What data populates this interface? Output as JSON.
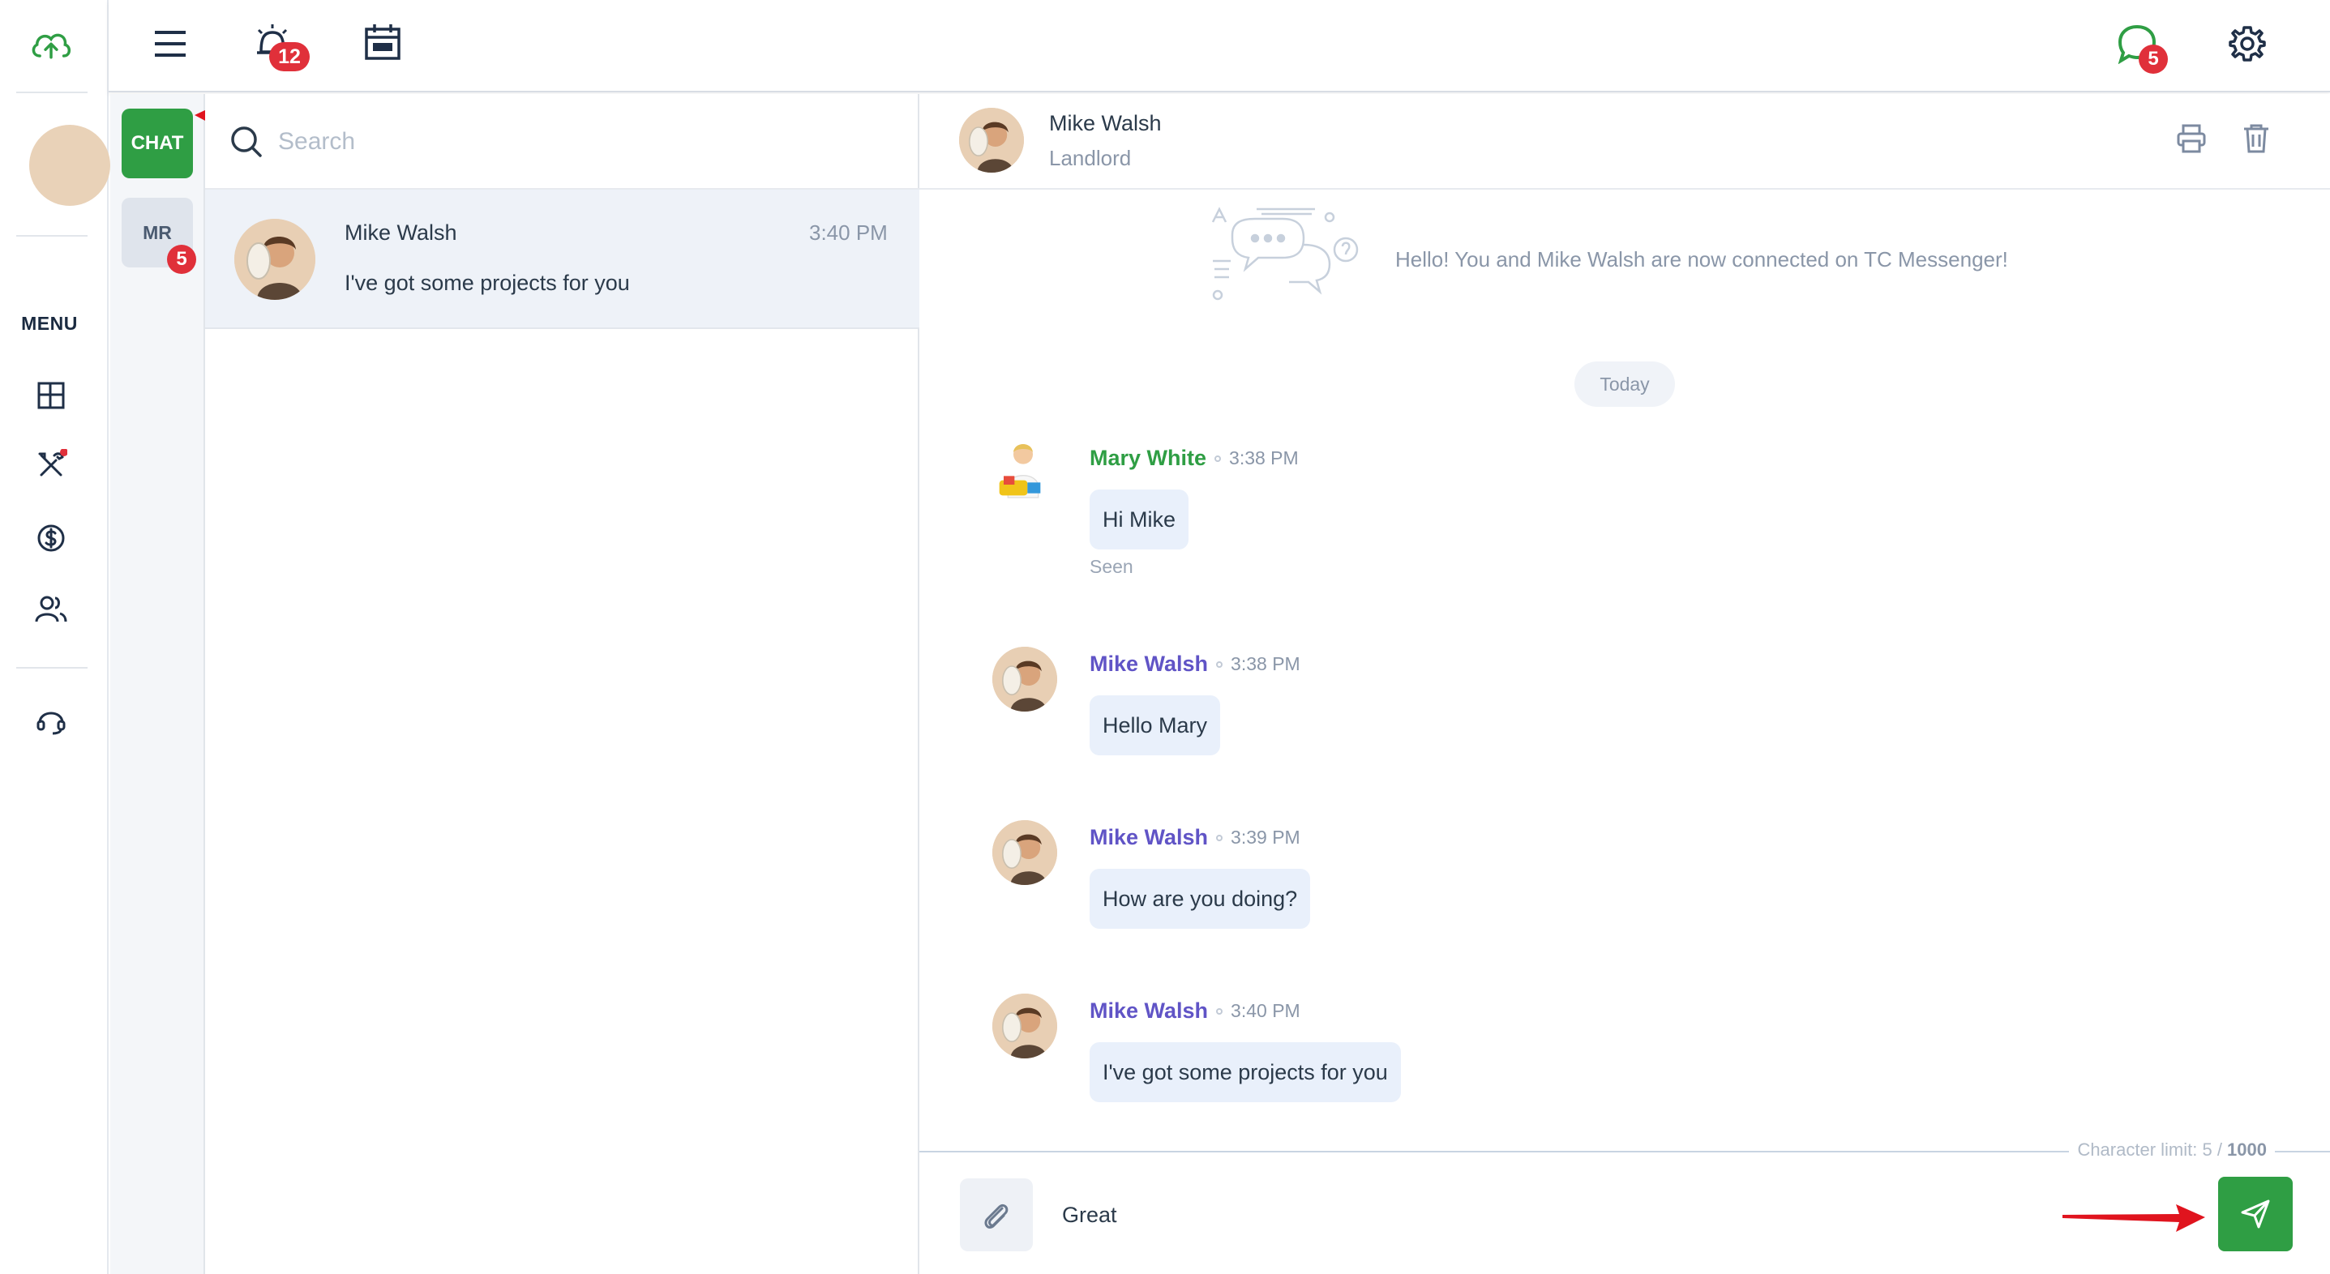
{
  "rail": {
    "menu_label": "MENU",
    "icons": [
      "cloud-upload-icon",
      "user-avatar",
      "dashboard-icon",
      "tools-icon",
      "dollar-icon",
      "users-icon",
      "headset-icon"
    ]
  },
  "topbar": {
    "alarm_badge": "12",
    "chat_badge": "5"
  },
  "rooms": {
    "chat_tab": "CHAT",
    "mr_tab": "MR",
    "mr_badge": "5"
  },
  "search": {
    "placeholder": "Search"
  },
  "conversations": [
    {
      "name": "Mike Walsh",
      "time": "3:40 PM",
      "preview": "I've got some projects for you"
    }
  ],
  "chat": {
    "contact_name": "Mike Walsh",
    "contact_role": "Landlord",
    "connected_text": "Hello! You and Mike Walsh are now connected on TC Messenger!",
    "day_label": "Today",
    "messages": [
      {
        "sender": "Mary White",
        "time": "3:38 PM",
        "text": "Hi Mike",
        "status": "Seen"
      },
      {
        "sender": "Mike Walsh",
        "time": "3:38 PM",
        "text": "Hello Mary"
      },
      {
        "sender": "Mike Walsh",
        "time": "3:39 PM",
        "text": "How are you doing?"
      },
      {
        "sender": "Mike Walsh",
        "time": "3:40 PM",
        "text": "I've got some projects for you"
      }
    ],
    "char_limit_label": "Character limit: 5 / ",
    "char_limit_max": "1000",
    "composer_value": "Great"
  },
  "colors": {
    "brand_green": "#2f9e44",
    "badge_red": "#e0303a",
    "sender_purple": "#6054c6",
    "bubble_bg": "#e9f0fb",
    "annotation_arrow": "#e0141e"
  }
}
